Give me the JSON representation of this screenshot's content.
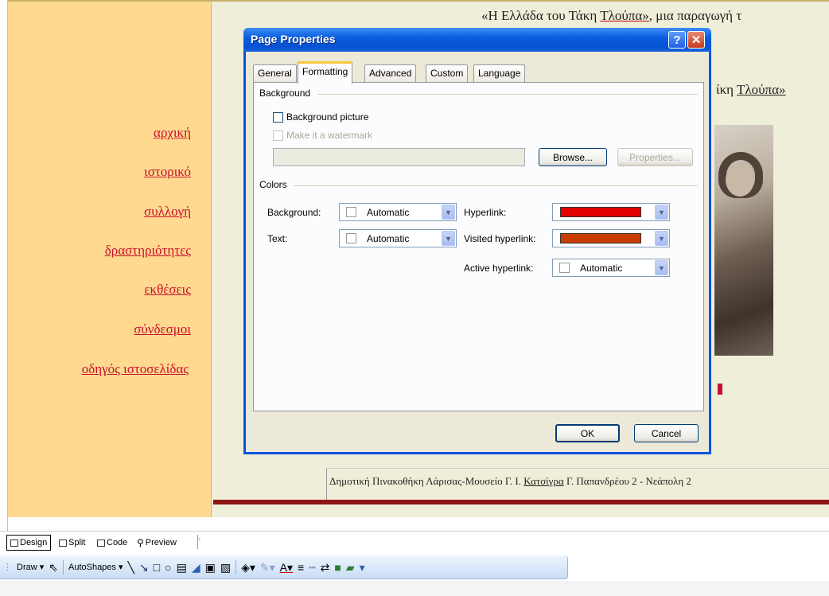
{
  "page": {
    "heading_prefix": "«Η Ελλάδα του Τάκη ",
    "heading_link": "Τλούπα»",
    "heading_suffix": ", μια παραγωγή τ",
    "subtitle_prefix": "ίκη ",
    "subtitle_link": "Τλούπα»",
    "footer_text_prefix": "Δημοτική Πινακοθήκη Λάρισας-Μουσείο Γ. Ι. ",
    "footer_text_link": "Κατσίγρα",
    "footer_text_suffix": " Γ. Παπανδρέου 2 - Νεάπολη 2"
  },
  "nav": [
    {
      "label": "αρχική"
    },
    {
      "label": "ιστορικό"
    },
    {
      "label": "συλλογή"
    },
    {
      "label": "δραστηριότητες"
    },
    {
      "label": "εκθέσεις"
    },
    {
      "label": "σύνδεσμοι"
    },
    {
      "label": "οδηγός ιστοσελίδας"
    }
  ],
  "dialog": {
    "title": "Page Properties",
    "help_label": "?",
    "close_label": "✕",
    "tabs": [
      "General",
      "Formatting",
      "Advanced",
      "Custom",
      "Language"
    ],
    "active_tab": "Formatting",
    "background_group": "Background",
    "background_picture_label": "Background picture",
    "watermark_label": "Make it a watermark",
    "browse_label": "Browse...",
    "properties_label": "Properties...",
    "colors_group": "Colors",
    "background_label": "Background:",
    "background_value": "Automatic",
    "text_label": "Text:",
    "text_value": "Automatic",
    "hyperlink_label": "Hyperlink:",
    "hyperlink_color": "#e00000",
    "visited_label": "Visited hyperlink:",
    "visited_color": "#c83c00",
    "active_label": "Active hyperlink:",
    "active_value": "Automatic",
    "ok_label": "OK",
    "cancel_label": "Cancel"
  },
  "views": {
    "design": "Design",
    "split": "Split",
    "code": "Code",
    "preview": "Preview"
  },
  "drawbar": {
    "draw": "Draw ▾",
    "autoshapes": "AutoShapes ▾"
  },
  "colors": {
    "sidebar_bg": "#ffd98f",
    "content_bg": "#efeed8",
    "link_color": "#c8102e",
    "stripe": "#8e1616",
    "xp_blue": "#0054e3"
  }
}
